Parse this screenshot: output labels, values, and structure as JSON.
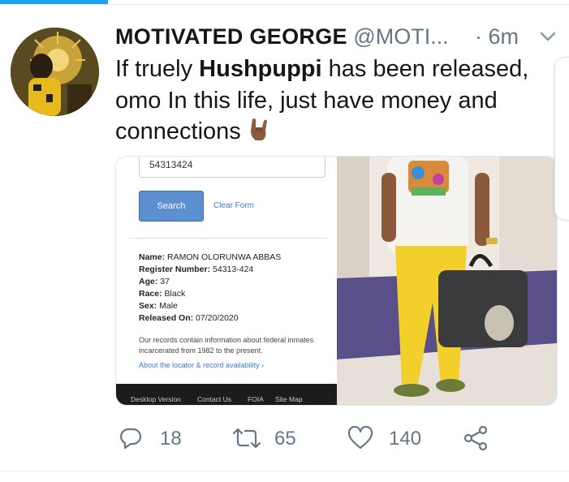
{
  "tweet": {
    "display_name": "MOTIVATED GEORGE",
    "handle": "@MOTI...",
    "time": "· 6m",
    "text_before": "If truely ",
    "text_bold": "Hushpuppi",
    "text_after": " has been released, omo In this life, just have money and connections"
  },
  "media": {
    "inmate_number_field": "54313424",
    "search_button": "Search",
    "clear_link": "Clear Form",
    "record": {
      "name_label": "Name:",
      "name_value": "RAMON OLORUNWA ABBAS",
      "register_label": "Register Number:",
      "register_value": "54313-424",
      "age_label": "Age:",
      "age_value": "37",
      "race_label": "Race:",
      "race_value": "Black",
      "sex_label": "Sex:",
      "sex_value": "Male",
      "released_label": "Released On:",
      "released_value": "07/20/2020"
    },
    "note": "Our records contain information about federal inmates incarcerated from 1982 to the present.",
    "about_link": "About the locator & record availability ›",
    "footer_links": [
      "Desktop Version",
      "Contact Us",
      "FOIA",
      "Site Map"
    ]
  },
  "actions": {
    "replies": "18",
    "retweets": "65",
    "likes": "140"
  },
  "colors": {
    "accent": "#1da1f2",
    "muted": "#657786",
    "text": "#14171a"
  }
}
